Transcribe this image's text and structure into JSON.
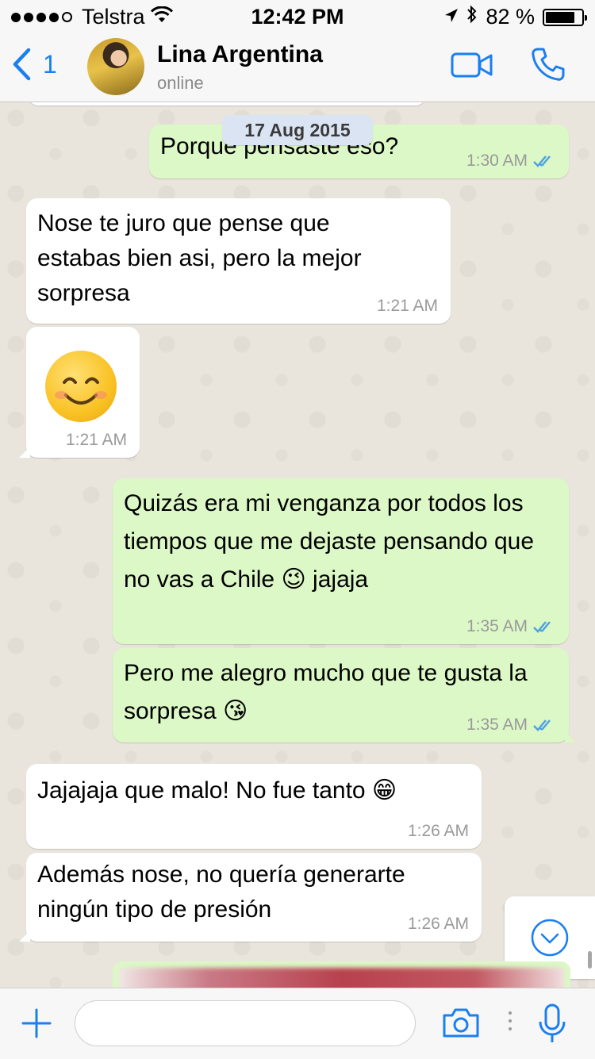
{
  "status_bar": {
    "carrier": "Telstra",
    "time": "12:42 PM",
    "battery_percent_label": "82 %",
    "battery_level": 0.82,
    "icons": [
      "signal-dots-icon",
      "wifi-icon",
      "location-arrow-icon",
      "bluetooth-icon",
      "battery-icon"
    ]
  },
  "header": {
    "back_count": "1",
    "contact_name": "Lina Argentina",
    "contact_status": "online",
    "icons": [
      "back-chevron-icon",
      "video-call-icon",
      "phone-icon"
    ]
  },
  "chat": {
    "date_chip": "17 Aug 2015",
    "messages": [
      {
        "dir": "out",
        "text": "Porque pensaste eso?",
        "time": "1:30 AM",
        "read": true
      },
      {
        "dir": "in",
        "text": "Nose te juro que pense que estabas bien asi, pero la mejor sorpresa",
        "time": "1:21 AM"
      },
      {
        "dir": "in",
        "text": "😊",
        "time": "1:21 AM"
      },
      {
        "dir": "out",
        "text": "Quizás era mi venganza por todos los tiempos que me dejaste pensando que no vas a Chile 😉 jajaja",
        "time": "1:35 AM",
        "read": true
      },
      {
        "dir": "out",
        "text": "Pero me alegro mucho que te gusta la sorpresa 😘",
        "time": "1:35 AM",
        "read": true
      },
      {
        "dir": "in",
        "text": "Jajajaja que malo! No fue tanto 😁",
        "time": "1:26 AM"
      },
      {
        "dir": "in",
        "text": "Además nose, no quería generarte ningún tipo de presión",
        "time": "1:26 AM"
      }
    ]
  },
  "input_bar": {
    "placeholder": "",
    "icons": [
      "plus-icon",
      "camera-icon",
      "mic-icon"
    ]
  },
  "colors": {
    "accent": "#1a7ff0",
    "outgoing_bubble": "#dcf8c6",
    "incoming_bubble": "#ffffff",
    "read_ticks": "#4fa3e0",
    "chat_background": "#e9e4dc"
  }
}
